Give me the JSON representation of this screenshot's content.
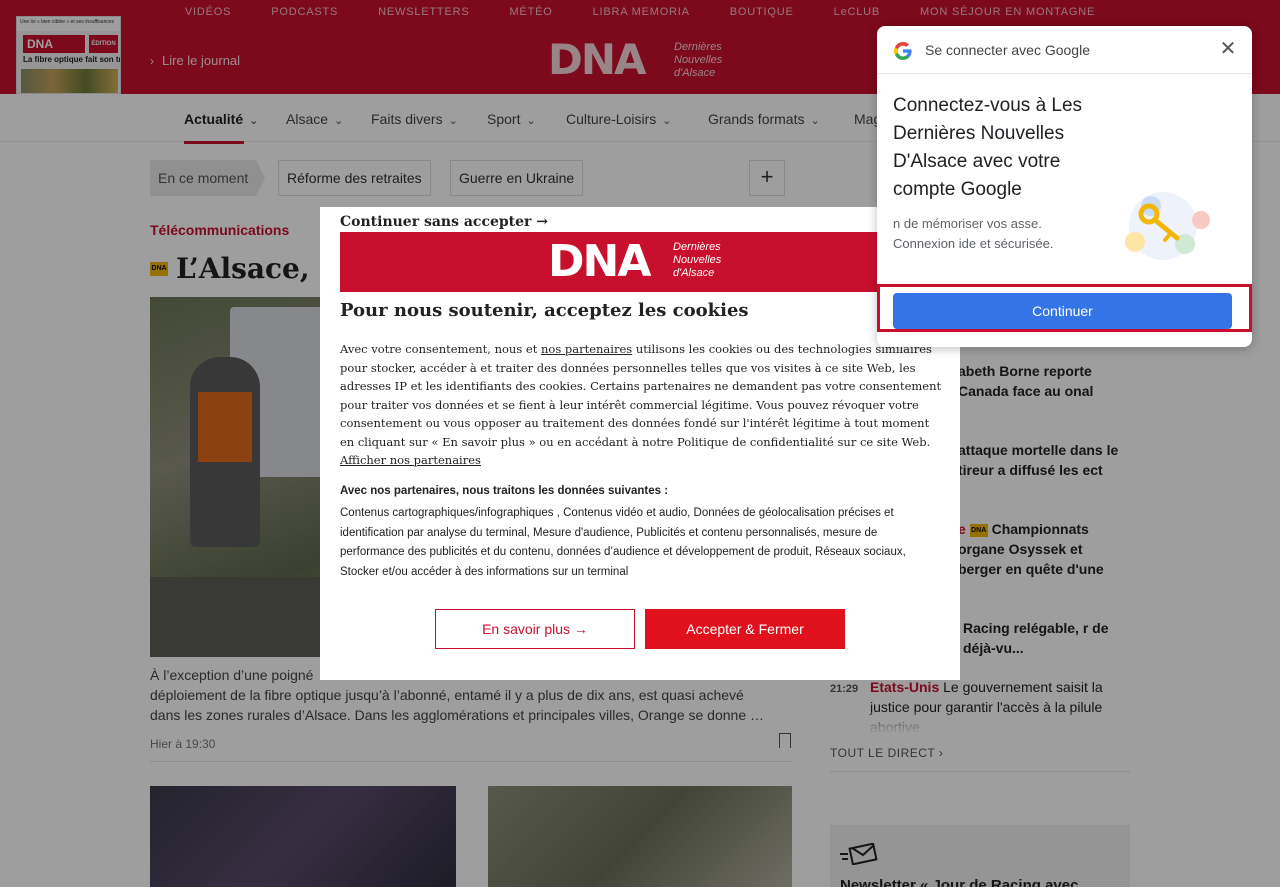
{
  "top_links": [
    "VIDÉOS",
    "PODCASTS",
    "NEWSLETTERS",
    "MÉTÉO",
    "LIBRA MEMORIA",
    "BOUTIQUE",
    "LeCLUB",
    "MON SÉJOUR EN MONTAGNE"
  ],
  "journal_thumb": {
    "header": "Une loi « bien ciblée » et ses insuffisances",
    "logo": "DNA",
    "edition": "ÉDITION",
    "headline": "La fibre optique fait son trou"
  },
  "read_journal": "Lire le journal",
  "brand": {
    "logo_big": "DNA",
    "logo_small_1": "Dernières",
    "logo_small_2": "Nouvelles",
    "logo_small_3": "d'Alsace",
    "accent": "#c8102e"
  },
  "nav": [
    "Actualité",
    "Alsace",
    "Faits divers",
    "Sport",
    "Culture-Loisirs",
    "Grands formats",
    "Mag"
  ],
  "tags": {
    "moment": "En ce moment",
    "items": [
      "Réforme des retraites",
      "Guerre en Ukraine"
    ],
    "plus": "+"
  },
  "article": {
    "kicker": "Télécommunications",
    "badge": "DNA",
    "headline_visible": "L’Alsace, t",
    "summary_1": "À l’exception d’une poigné",
    "summary_2": "déploiement de la fibre optique jusqu’à l’abonné, entamé il y a plus de dix ans, est quasi achevé",
    "summary_3": "dans les zones rurales d’Alsace. Dans les agglomérations et principales villes, Orange se donne …",
    "time": "Hier à 19:30"
  },
  "feed": [
    {
      "time": "",
      "category": "",
      "text": "abeth Borne reporte Canada face au onal"
    },
    {
      "time": "",
      "category": "",
      "text": "attaque mortelle dans le tireur a diffusé les ect"
    },
    {
      "time": "",
      "category": "e",
      "badge": "DNA",
      "text": "Championnats organe Osyssek et berger en quête d'une"
    },
    {
      "time": "",
      "category": "",
      "text": "Racing relégable, r de déjà-vu..."
    },
    {
      "time": "21:29",
      "category": "Etats-Unis",
      "text": "Le gouvernement saisit la justice pour garantir l'accès à la pilule abortive"
    }
  ],
  "feed_all": "TOUT LE DIRECT",
  "newsletter_teaser": "Newsletter « Jour de Racing avec",
  "cookie": {
    "skip": "Continuer sans accepter →",
    "banner_big": "DNA",
    "banner_small_1": "Dernières",
    "banner_small_2": "Nouvelles",
    "banner_small_3": "d'Alsace",
    "title": "Pour nous soutenir, acceptez les cookies",
    "p1_a": "Avec votre consentement, nous et ",
    "p1_link": "nos partenaires",
    "p1_b": " utilisons les cookies ou des technologies similaires pour stocker, accéder à et traiter des données personnelles telles que vos visites à ce site Web, les adresses IP et les identifiants des cookies. Certains partenaires ne demandent pas votre consentement pour traiter vos données et se fient à leur intérêt commercial légitime. Vous pouvez révoquer votre consentement ou vous opposer au traitement des données fondé sur l'intérêt légitime à tout moment en cliquant sur « En savoir plus » ou en accédant à notre Politique de confidentialité sur ce site Web. ",
    "p1_link2": "Afficher nos partenaires",
    "p2_title": "Avec nos partenaires, nous traitons les données suivantes :",
    "p2": "Contenus cartographiques/infographiques , Contenus vidéo et audio, Données de géolocalisation précises et identification par analyse du terminal, Mesure d'audience, Publicités et contenu personnalisés, mesure de performance des publicités et du contenu, données d’audience et développement de produit, Réseaux sociaux, Stocker et/ou accéder à des informations sur un terminal",
    "btn_more": "En savoir plus →",
    "btn_accept": "Accepter & Fermer"
  },
  "google": {
    "title": "Se connecter avec Google",
    "heading": "Connectez-vous à Les Dernières Nouvelles D'Alsace avec votre compte Google",
    "text": "n de mémoriser vos asse. Connexion ide et sécurisée.",
    "button": "Continuer"
  }
}
